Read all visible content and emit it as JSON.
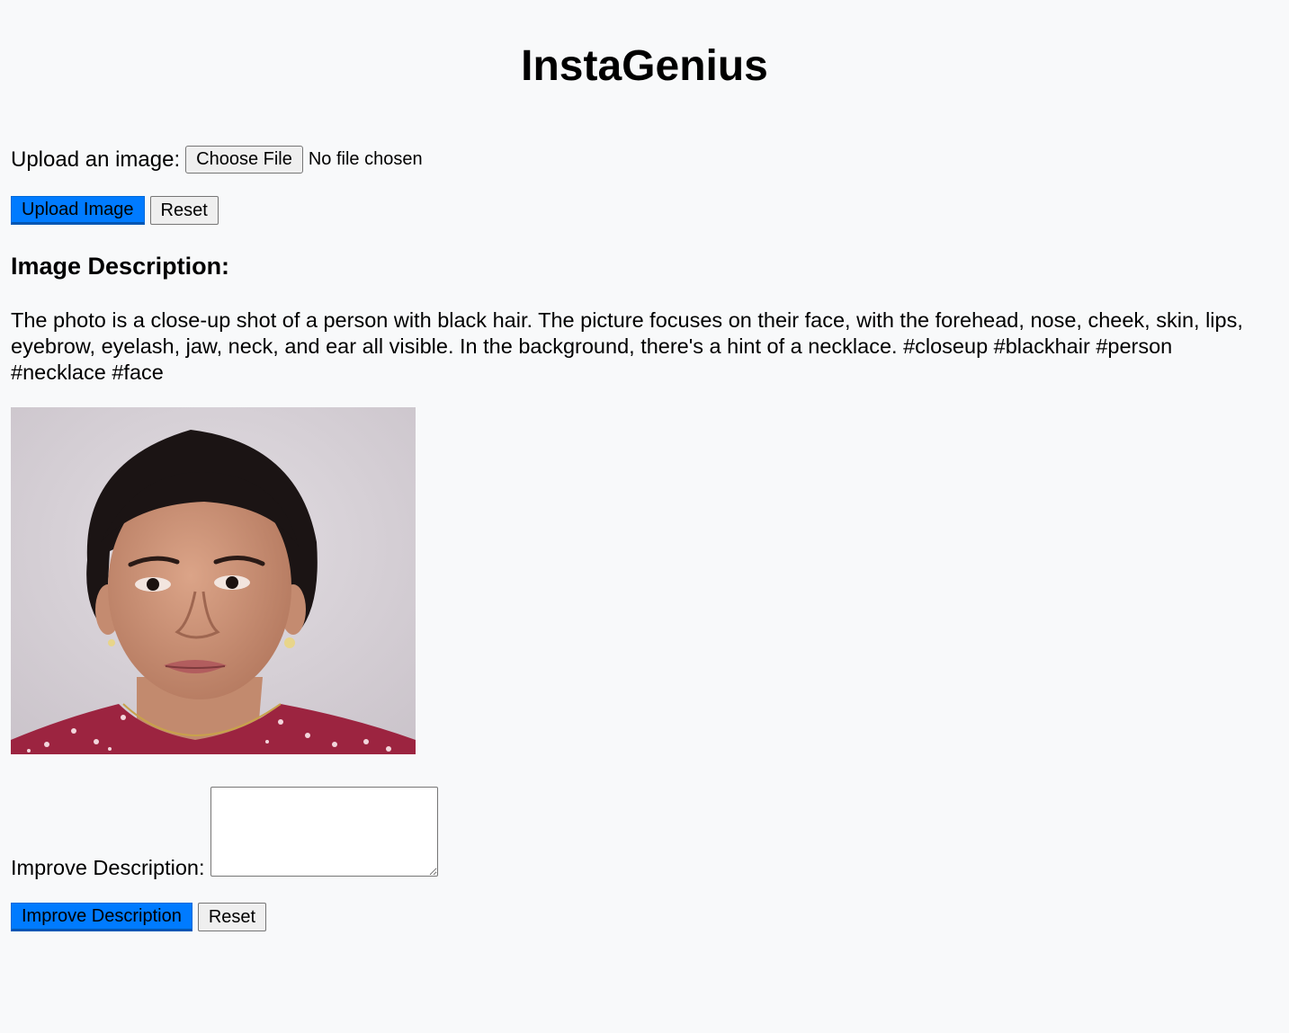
{
  "app": {
    "title": "InstaGenius"
  },
  "upload": {
    "label": "Upload an image:",
    "choose_file_label": "Choose File",
    "file_status": "No file chosen",
    "upload_button": "Upload Image",
    "reset_button": "Reset"
  },
  "description": {
    "heading": "Image Description:",
    "text": "The photo is a close-up shot of a person with black hair. The picture focuses on their face, with the forehead, nose, cheek, skin, lips, eyebrow, eyelash, jaw, neck, and ear all visible. In the background, there's a hint of a necklace. #closeup #blackhair #person #necklace #face"
  },
  "improve": {
    "label": "Improve Description:",
    "textarea_value": "",
    "improve_button": "Improve Description",
    "reset_button": "Reset"
  },
  "colors": {
    "background": "#f8f9fa",
    "primary_button": "#007bff"
  }
}
